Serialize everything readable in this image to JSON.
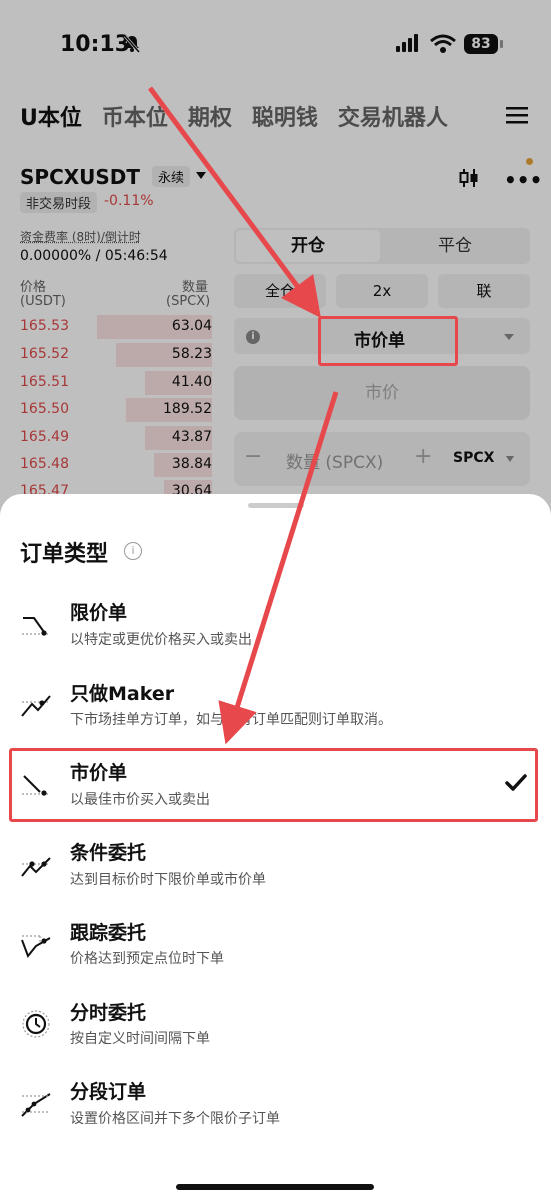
{
  "status_bar": {
    "time": "10:13",
    "battery": "83"
  },
  "top_tabs": [
    "U本位",
    "币本位",
    "期权",
    "聪明钱",
    "交易机器人"
  ],
  "pair": {
    "symbol": "SPCXUSDT",
    "badge": "永续",
    "non_trading": "非交易时段",
    "change": "-0.11%"
  },
  "funding": {
    "label": "资金费率 (8时)/倒计时",
    "value": "0.00000% / 05:46:54"
  },
  "orderbook": {
    "price_header": "价格",
    "price_unit": "(USDT)",
    "qty_header": "数量",
    "qty_unit": "(SPCX)",
    "rows": [
      {
        "price": "165.53",
        "qty": "63.04",
        "depth": 0.6
      },
      {
        "price": "165.52",
        "qty": "58.23",
        "depth": 0.5
      },
      {
        "price": "165.51",
        "qty": "41.40",
        "depth": 0.35
      },
      {
        "price": "165.50",
        "qty": "189.52",
        "depth": 0.45
      },
      {
        "price": "165.49",
        "qty": "43.87",
        "depth": 0.35
      },
      {
        "price": "165.48",
        "qty": "38.84",
        "depth": 0.3
      },
      {
        "price": "165.47",
        "qty": "30.64",
        "depth": 0.25
      }
    ]
  },
  "trade_panel": {
    "open": "开仓",
    "close": "平仓",
    "margin_mode": "全仓",
    "leverage": "2x",
    "linked": "联",
    "order_type": "市价单",
    "market_placeholder": "市价",
    "qty_placeholder": "数量 (SPCX)",
    "qty_unit": "SPCX"
  },
  "sheet": {
    "title": "订单类型",
    "options": [
      {
        "title": "限价单",
        "desc": "以特定或更优价格买入或卖出",
        "icon": "limit-order-icon"
      },
      {
        "title": "只做Maker",
        "desc": "下市场挂单方订单，如与现有订单匹配则订单取消。",
        "icon": "maker-only-icon"
      },
      {
        "title": "市价单",
        "desc": "以最佳市价买入或卖出",
        "icon": "market-order-icon",
        "selected": true
      },
      {
        "title": "条件委托",
        "desc": "达到目标价时下限价单或市价单",
        "icon": "conditional-order-icon"
      },
      {
        "title": "跟踪委托",
        "desc": "价格达到预定点位时下单",
        "icon": "trailing-order-icon"
      },
      {
        "title": "分时委托",
        "desc": "按自定义时间间隔下单",
        "icon": "clock-icon"
      },
      {
        "title": "分段订单",
        "desc": "设置价格区间并下多个限价子订单",
        "icon": "scaled-order-icon"
      }
    ]
  },
  "colors": {
    "red": "#e04b4b",
    "annotation": "#e7484c"
  }
}
